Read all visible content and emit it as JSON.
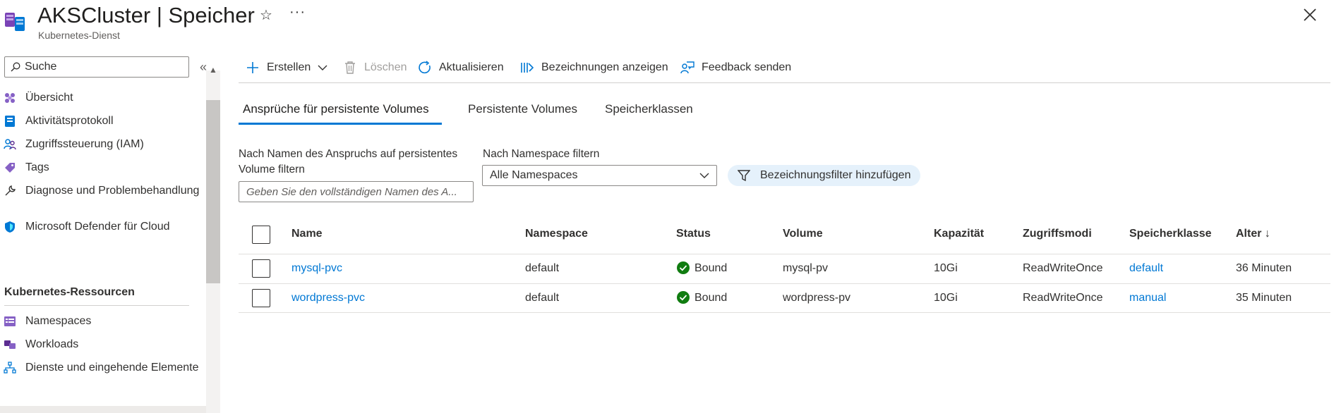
{
  "header": {
    "title": "AKSCluster | Speicher",
    "subtitle": "Kubernetes-Dienst",
    "favorite_symbol": "☆",
    "more_symbol": "···"
  },
  "sidebar": {
    "search_placeholder": "Suche",
    "collapse_symbol": "«",
    "items": [
      {
        "label": "Übersicht",
        "icon": "kubernetes-overview-icon"
      },
      {
        "label": "Aktivitätsprotokoll",
        "icon": "activity-log-icon"
      },
      {
        "label": "Zugriffssteuerung (IAM)",
        "icon": "iam-people-icon"
      },
      {
        "label": "Tags",
        "icon": "tag-icon"
      },
      {
        "label": "Diagnose und Problembehandlung",
        "icon": "wrench-icon"
      },
      {
        "label": "Microsoft Defender für Cloud",
        "icon": "shield-icon"
      }
    ],
    "section_title": "Kubernetes-Ressourcen",
    "section_items": [
      {
        "label": "Namespaces",
        "icon": "namespaces-icon"
      },
      {
        "label": "Workloads",
        "icon": "workloads-icon"
      },
      {
        "label": "Dienste und eingehende Elemente",
        "icon": "services-network-icon"
      }
    ]
  },
  "toolbar": {
    "create": "Erstellen",
    "delete": "Löschen",
    "refresh": "Aktualisieren",
    "show_labels": "Bezeichnungen anzeigen",
    "feedback": "Feedback senden"
  },
  "tabs": [
    {
      "label": "Ansprüche für persistente Volumes",
      "active": true
    },
    {
      "label": "Persistente Volumes",
      "active": false
    },
    {
      "label": "Speicherklassen",
      "active": false
    }
  ],
  "filters": {
    "name_label": "Nach Namen des Anspruchs auf persistentes Volume filtern",
    "name_label_line1": "Nach Namen des Anspruchs auf persistentes",
    "name_label_line2": "Volume filtern",
    "name_placeholder": "Geben Sie den vollständigen Namen des A...",
    "namespace_label": "Nach Namespace filtern",
    "namespace_value": "Alle Namespaces",
    "label_filter_button": "Bezeichnungsfilter hinzufügen"
  },
  "table": {
    "columns": [
      "Name",
      "Namespace",
      "Status",
      "Volume",
      "Kapazität",
      "Zugriffsmodi",
      "Speicherklasse",
      "Alter ↓"
    ],
    "rows": [
      {
        "name": "mysql-pvc",
        "namespace": "default",
        "status": "Bound",
        "volume": "mysql-pv",
        "capacity": "10Gi",
        "access": "ReadWriteOnce",
        "storage_class": "default",
        "age": "36 Minuten"
      },
      {
        "name": "wordpress-pvc",
        "namespace": "default",
        "status": "Bound",
        "volume": "wordpress-pv",
        "capacity": "10Gi",
        "access": "ReadWriteOnce",
        "storage_class": "manual",
        "age": "35 Minuten"
      }
    ]
  },
  "colors": {
    "accent": "#0078d4",
    "success": "#107c10",
    "pill_bg": "#e5f1fb"
  }
}
